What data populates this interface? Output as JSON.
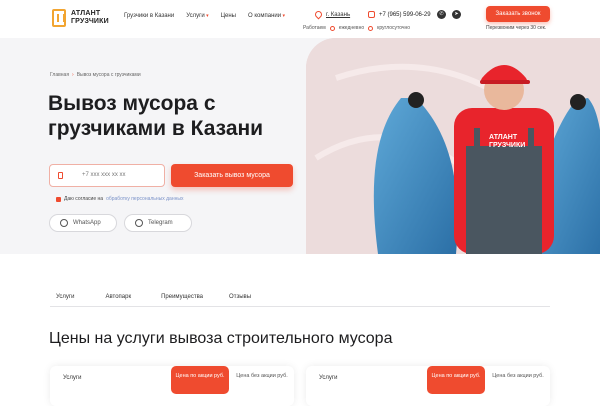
{
  "header": {
    "logo_line1": "АТЛАНТ",
    "logo_line2": "ГРУЗЧИКИ",
    "nav": [
      "Грузчики в Казани",
      "Услуги",
      "Цены",
      "О компании"
    ],
    "city": "г. Казань",
    "hours_label": "Работаем",
    "hours_daily": "ежедневно",
    "hours_round": "круглосуточно",
    "phone": "+7 (965) 599-06-29",
    "socials": [
      "whatsapp-icon",
      "telegram-icon"
    ],
    "cta": "Заказать звонок",
    "callback_note": "Перезвоним через 30 сек."
  },
  "hero": {
    "breadcrumb_home": "Главная",
    "breadcrumb_current": "Вывоз мусора с грузчиками",
    "title_line1": "Вывоз мусора с",
    "title_line2": "грузчиками в Казани",
    "phone_placeholder": "+7 xxx xxx xx xx",
    "order_button": "Заказать вывоз мусора",
    "consent_text": "Даю согласие на",
    "consent_link": "обработку персональных данных",
    "whatsapp": "WhatsApp",
    "telegram": "Telegram",
    "cap_brand_line1": "АТЛАНТ",
    "cap_brand_line2": "ГРУЗЧИКИ"
  },
  "tabs": [
    "Услуги",
    "Автопарк",
    "Преимущества",
    "Отзывы"
  ],
  "prices": {
    "title": "Цены на услуги вывоза строительного мусора",
    "cards": [
      {
        "col_name": "Услуги",
        "col_promo": "Цена по акции руб.",
        "col_reg": "Цена без акции руб."
      },
      {
        "col_name": "Услуги",
        "col_promo": "Цена по акции руб.",
        "col_reg": "Цена без акции руб."
      }
    ]
  },
  "colors": {
    "accent": "#ef4b2f",
    "logo": "#f2a531",
    "hero_bg": "#f5f5f7"
  }
}
